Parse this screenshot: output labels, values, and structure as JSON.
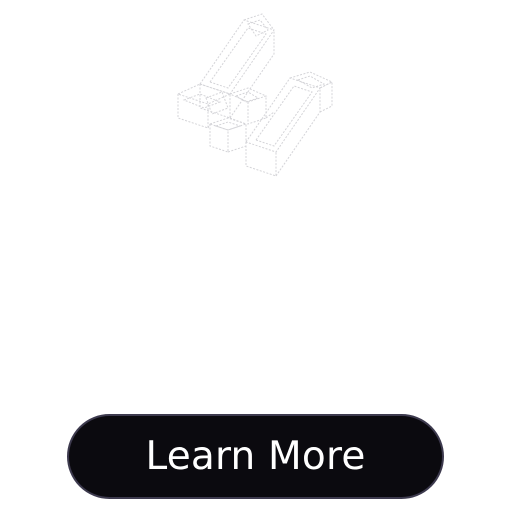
{
  "cta": {
    "label": "Learn More"
  },
  "illustration": {
    "icon": "isometric-blocks-icon",
    "stroke_color": "#d4d4d8"
  },
  "colors": {
    "background": "#ffffff",
    "button_fill": "#0b0a0f",
    "button_border": "#3d3a4e",
    "button_text": "#ffffff"
  }
}
